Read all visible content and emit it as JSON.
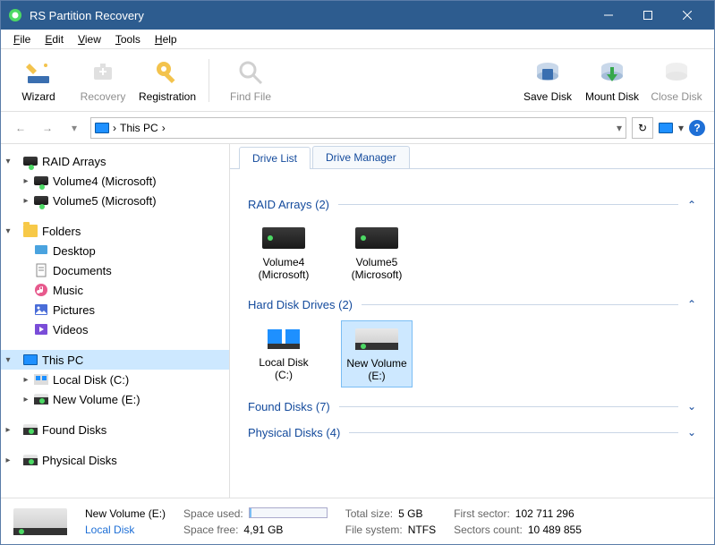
{
  "window": {
    "title": "RS Partition Recovery"
  },
  "menu": {
    "file": "File",
    "edit": "Edit",
    "view": "View",
    "tools": "Tools",
    "help": "Help"
  },
  "toolbar": {
    "wizard": "Wizard",
    "recovery": "Recovery",
    "registration": "Registration",
    "find_file": "Find File",
    "save_disk": "Save Disk",
    "mount_disk": "Mount Disk",
    "close_disk": "Close Disk"
  },
  "nav": {
    "location": "This PC",
    "sep": "›"
  },
  "tree": {
    "raid": {
      "label": "RAID Arrays",
      "items": [
        "Volume4 (Microsoft)",
        "Volume5 (Microsoft)"
      ]
    },
    "folders": {
      "label": "Folders",
      "items": [
        "Desktop",
        "Documents",
        "Music",
        "Pictures",
        "Videos"
      ]
    },
    "this_pc": {
      "label": "This PC",
      "items": [
        "Local Disk (C:)",
        "New Volume (E:)"
      ]
    },
    "found": {
      "label": "Found Disks"
    },
    "physical": {
      "label": "Physical Disks"
    }
  },
  "tabs": {
    "drive_list": "Drive List",
    "drive_manager": "Drive Manager"
  },
  "sections": {
    "raid": {
      "label": "RAID Arrays (2)",
      "items": [
        "Volume4 (Microsoft)",
        "Volume5 (Microsoft)"
      ]
    },
    "hdd": {
      "label": "Hard Disk Drives (2)",
      "items": [
        "Local Disk (C:)",
        "New Volume (E:)"
      ]
    },
    "found": {
      "label": "Found Disks (7)"
    },
    "physical": {
      "label": "Physical Disks (4)"
    }
  },
  "status": {
    "name": "New Volume (E:)",
    "type": "Local Disk",
    "space_used_label": "Space used:",
    "space_free_label": "Space free:",
    "space_free": "4,91 GB",
    "total_size_label": "Total size:",
    "total_size": "5 GB",
    "fs_label": "File system:",
    "fs": "NTFS",
    "first_sector_label": "First sector:",
    "first_sector": "102 711 296",
    "sectors_label": "Sectors count:",
    "sectors": "10 489 855"
  }
}
